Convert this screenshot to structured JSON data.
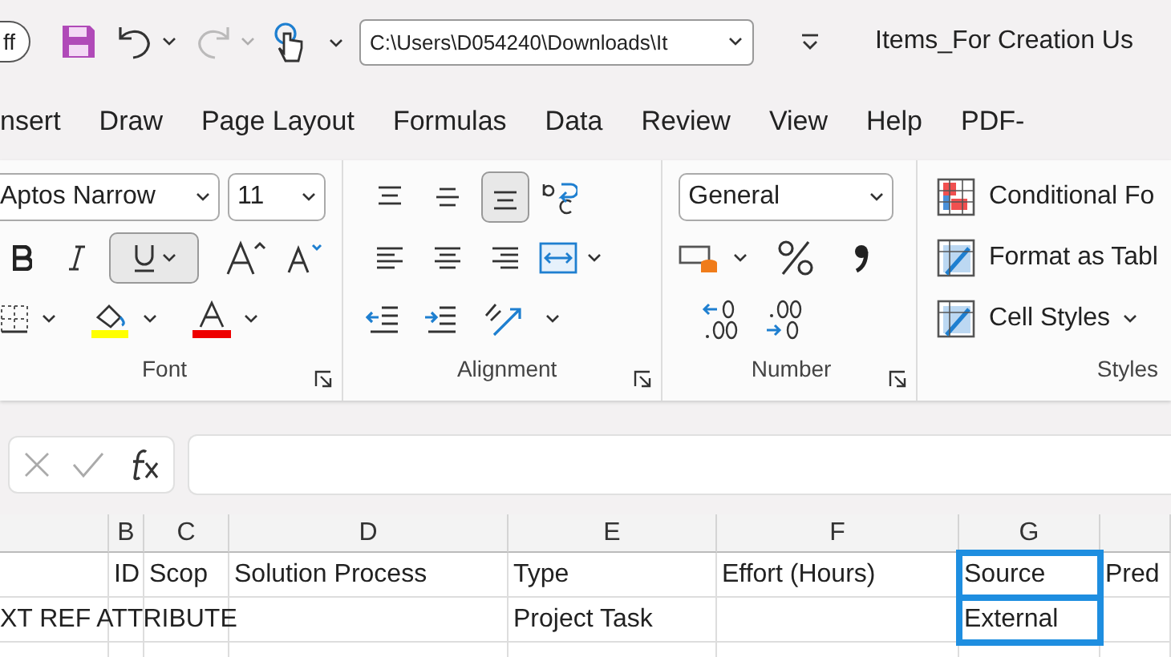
{
  "quick_access": {
    "autosave": "ff",
    "redo": {
      "disabled": true
    },
    "file_path": "C:\\Users\\D054240\\Downloads\\It"
  },
  "window": {
    "title": "Items_For Creation Us"
  },
  "tabs": [
    {
      "label": "nsert",
      "selected": false
    },
    {
      "label": "Draw",
      "selected": false
    },
    {
      "label": "Page Layout",
      "selected": false
    },
    {
      "label": "Formulas",
      "selected": false
    },
    {
      "label": "Data",
      "selected": false
    },
    {
      "label": "Review",
      "selected": false
    },
    {
      "label": "View",
      "selected": false
    },
    {
      "label": "Help",
      "selected": false
    },
    {
      "label": "PDF-",
      "selected": false
    }
  ],
  "ribbon": {
    "font": {
      "label": "Font",
      "font_name": "Aptos Narrow",
      "font_size": "11",
      "bold": false,
      "italic": false,
      "underline": true
    },
    "alignment": {
      "label": "Alignment",
      "vertical_align": [
        {
          "selected": false
        },
        {
          "selected": false
        },
        {
          "selected": true
        }
      ],
      "horizontal_align": [
        {
          "selected": false
        },
        {
          "selected": false
        },
        {
          "selected": false
        }
      ]
    },
    "number": {
      "label": "Number",
      "format": "General"
    },
    "styles": {
      "label": "Styles",
      "items": [
        "Conditional Fo",
        "Format as Tabl",
        "Cell Styles"
      ]
    }
  },
  "sheet": {
    "columns": [
      "",
      "B",
      "C",
      "D",
      "E",
      "F",
      "G",
      ""
    ],
    "rows": [
      {
        "cells": [
          {
            "text": "",
            "selected": false
          },
          {
            "text": "ID",
            "selected": false
          },
          {
            "text": "Scop",
            "selected": false
          },
          {
            "text": "Solution Process",
            "selected": false
          },
          {
            "text": "Type",
            "selected": false
          },
          {
            "text": "Effort (Hours)",
            "selected": false
          },
          {
            "text": "Source",
            "selected": true
          },
          {
            "text": "Pred",
            "selected": false
          }
        ]
      },
      {
        "cells": [
          {
            "text": "XT REF ATTRIBUTE",
            "selected": false
          },
          {
            "text": "",
            "selected": false
          },
          {
            "text": "",
            "selected": false
          },
          {
            "text": "",
            "selected": false
          },
          {
            "text": "Project Task",
            "selected": false
          },
          {
            "text": "",
            "selected": false
          },
          {
            "text": "External",
            "selected": true
          },
          {
            "text": "",
            "selected": false
          }
        ]
      }
    ]
  }
}
